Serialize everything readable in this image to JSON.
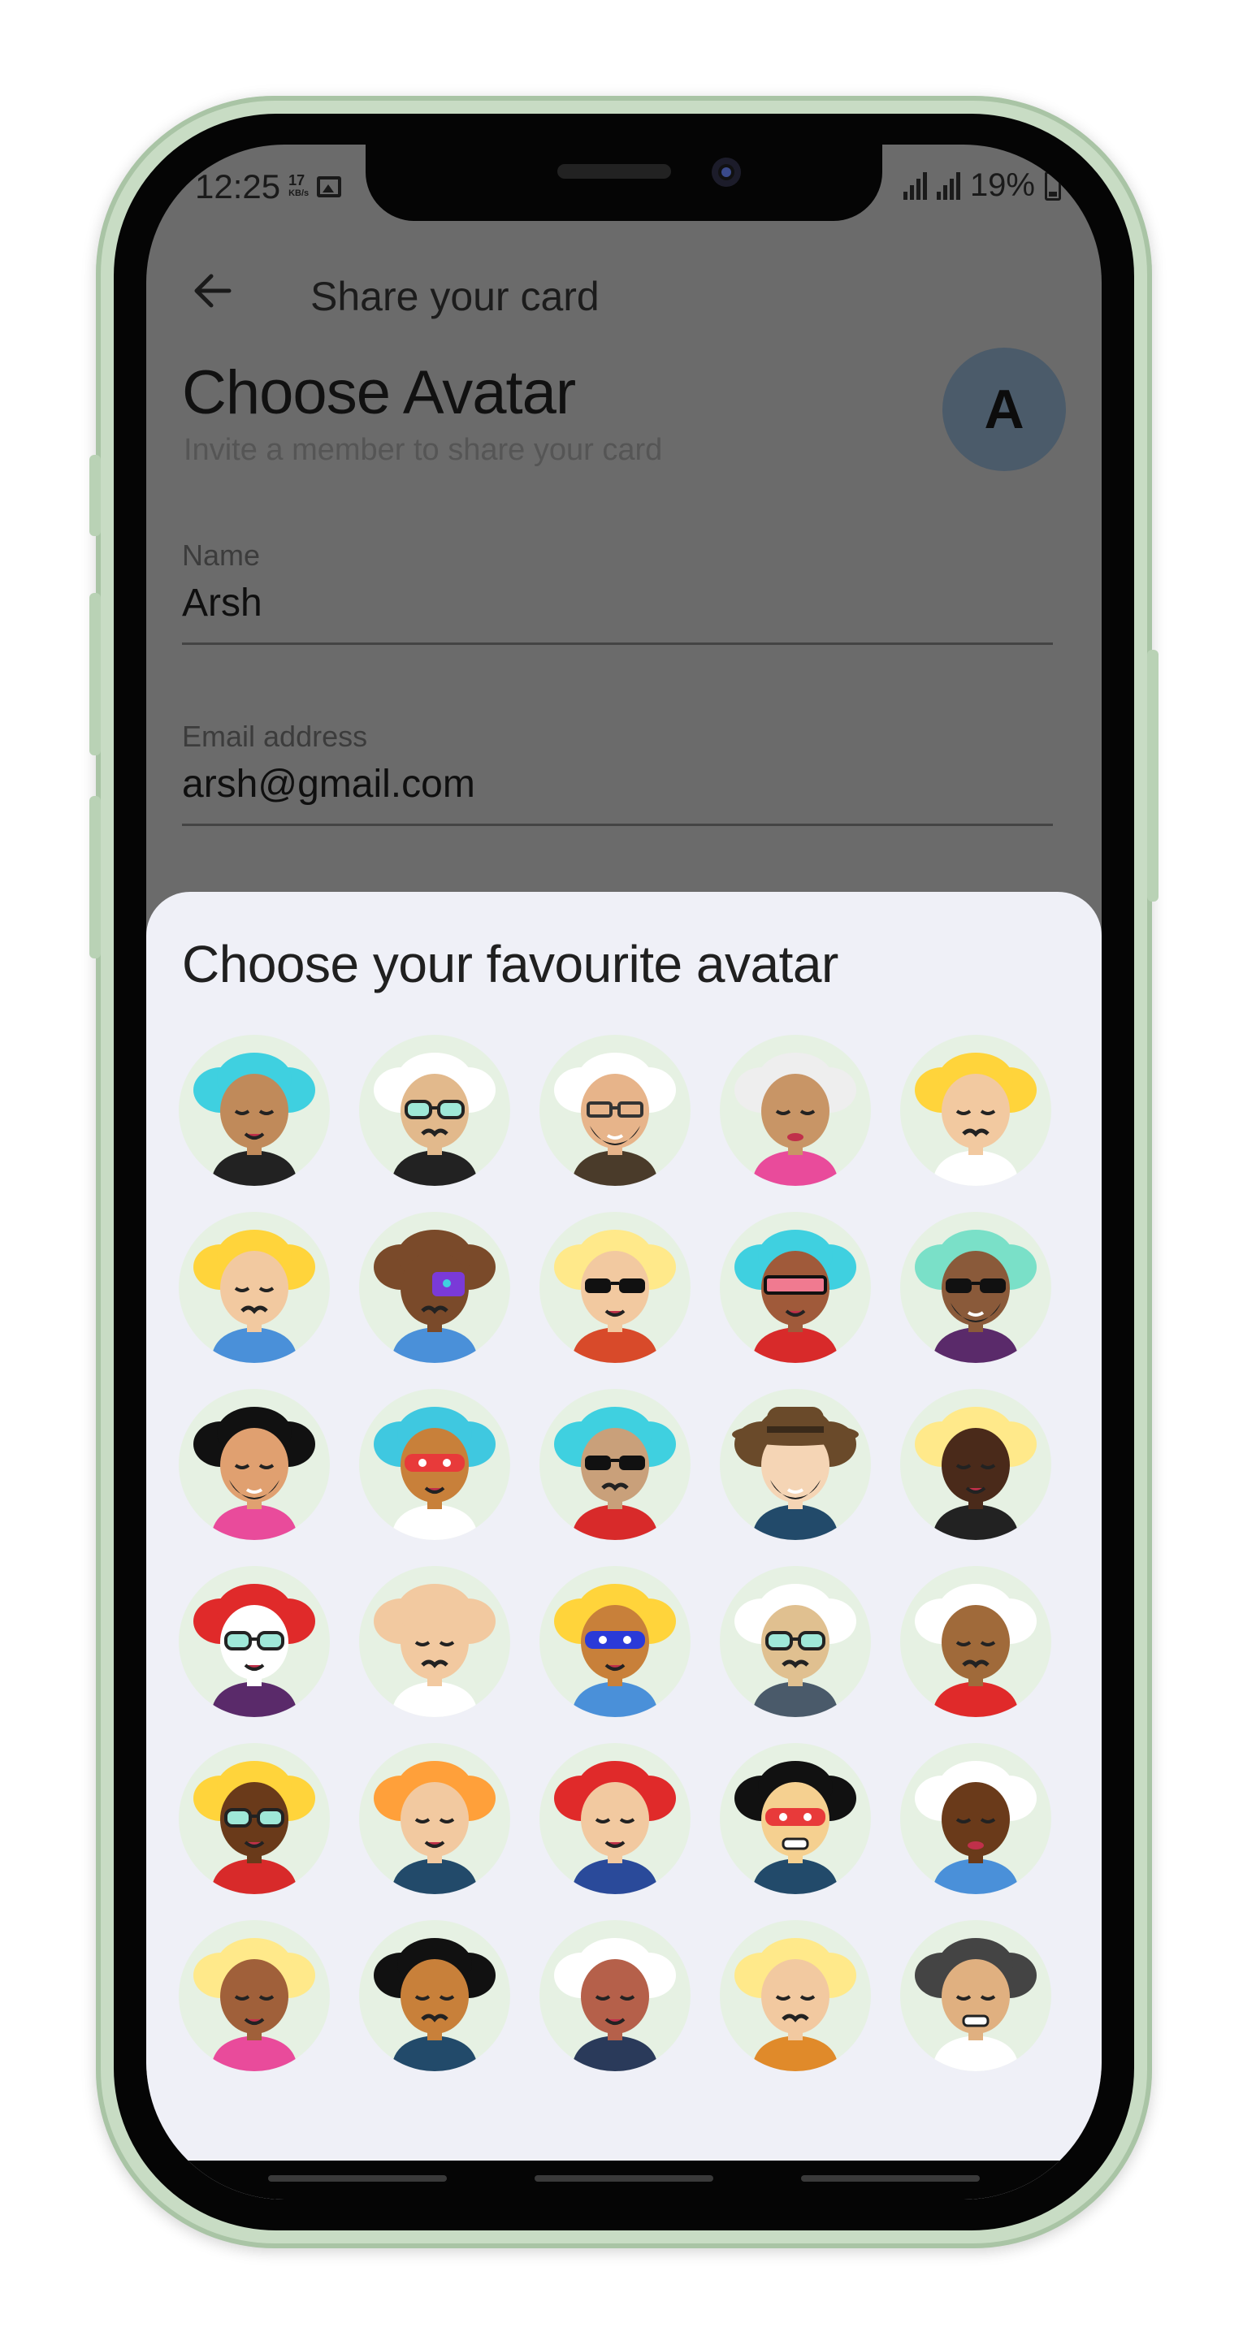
{
  "status_bar": {
    "time": "12:25",
    "speed_value": "17",
    "speed_unit": "KB/s",
    "battery": "19%"
  },
  "appbar": {
    "back_icon": "back-arrow-icon",
    "title": "Share your card"
  },
  "header": {
    "title": "Choose Avatar",
    "subtitle": "Invite a member to share your card",
    "avatar_initial": "A"
  },
  "form": {
    "name_label": "Name",
    "name_value": "Arsh",
    "email_label": "Email address",
    "email_value": "arsh@gmail.com"
  },
  "sheet": {
    "title": "Choose your favourite avatar",
    "avatars": [
      {
        "skin": "#c08a5a",
        "hair": "#3fd0e0",
        "acc": "none",
        "shirt": "#222222",
        "mouth": "smile"
      },
      {
        "skin": "#e2b98c",
        "hair": "#ffffff",
        "acc": "glasses-mint",
        "shirt": "#222222",
        "mouth": "mustache"
      },
      {
        "skin": "#e7b48a",
        "hair": "#ffffff",
        "acc": "glasses-outline",
        "shirt": "#4a3b2a",
        "mouth": "beard"
      },
      {
        "skin": "#c89566",
        "hair": "#eeeeee",
        "acc": "none",
        "shirt": "#e94b9b",
        "mouth": "lips"
      },
      {
        "skin": "#f2c9a0",
        "hair": "#ffd43b",
        "acc": "none",
        "shirt": "#ffffff",
        "mouth": "mustache"
      },
      {
        "skin": "#f2c9a0",
        "hair": "#ffd43b",
        "acc": "none",
        "shirt": "#4a90d9",
        "mouth": "mustache"
      },
      {
        "skin": "#7a4a2a",
        "hair": "#7a4a2a",
        "acc": "mask-purple",
        "shirt": "#4a90d9",
        "mouth": "mustache"
      },
      {
        "skin": "#f2c9a0",
        "hair": "#ffe98a",
        "acc": "glasses-black",
        "shirt": "#d84a2a",
        "mouth": "smile"
      },
      {
        "skin": "#a05a3a",
        "hair": "#3fd0e0",
        "acc": "visor-pink",
        "shirt": "#d82a2a",
        "mouth": "smile"
      },
      {
        "skin": "#8a5a3a",
        "hair": "#7ae0c8",
        "acc": "glasses-black",
        "shirt": "#5a2a6a",
        "mouth": "beard"
      },
      {
        "skin": "#e0a070",
        "hair": "#111111",
        "acc": "none",
        "shirt": "#e94b9b",
        "mouth": "beard"
      },
      {
        "skin": "#c8803a",
        "hair": "#3fc8e0",
        "acc": "mask-red",
        "shirt": "#ffffff",
        "mouth": "smile"
      },
      {
        "skin": "#c9a07a",
        "hair": "#3fd0e0",
        "acc": "glasses-black",
        "shirt": "#d82a2a",
        "mouth": "mustache"
      },
      {
        "skin": "#f5d5b5",
        "hair": "#6a4a2a",
        "acc": "hat",
        "shirt": "#224a6a",
        "mouth": "beard"
      },
      {
        "skin": "#4a2a1a",
        "hair": "#ffe98a",
        "acc": "none",
        "shirt": "#222222",
        "mouth": "smile"
      },
      {
        "skin": "#ffffff",
        "hair": "#e02a2a",
        "acc": "glasses-mint",
        "shirt": "#5a2a6a",
        "mouth": "smile"
      },
      {
        "skin": "#f2c9a0",
        "hair": "#f2c9a0",
        "acc": "none",
        "shirt": "#ffffff",
        "mouth": "mustache"
      },
      {
        "skin": "#c8803a",
        "hair": "#ffd43b",
        "acc": "mask-blue",
        "shirt": "#4a90d9",
        "mouth": "smile"
      },
      {
        "skin": "#e0c090",
        "hair": "#ffffff",
        "acc": "glasses-mint",
        "shirt": "#4a5a6a",
        "mouth": "mustache"
      },
      {
        "skin": "#a06a3a",
        "hair": "#ffffff",
        "acc": "none",
        "shirt": "#e02a2a",
        "mouth": "mustache"
      },
      {
        "skin": "#6a3a1a",
        "hair": "#ffd43b",
        "acc": "glasses-mint",
        "shirt": "#d82a2a",
        "mouth": "smile"
      },
      {
        "skin": "#f2c9a0",
        "hair": "#ffa03a",
        "acc": "none",
        "shirt": "#224a6a",
        "mouth": "smile"
      },
      {
        "skin": "#f2c9a0",
        "hair": "#e02a2a",
        "acc": "none",
        "shirt": "#2a4a9a",
        "mouth": "smile"
      },
      {
        "skin": "#f5d090",
        "hair": "#111111",
        "acc": "mask-red",
        "shirt": "#224a6a",
        "mouth": "teeth"
      },
      {
        "skin": "#6a3a1a",
        "hair": "#ffffff",
        "acc": "none",
        "shirt": "#4a90d9",
        "mouth": "lips"
      },
      {
        "skin": "#a0603a",
        "hair": "#ffe98a",
        "acc": "none",
        "shirt": "#e94b9b",
        "mouth": "smile"
      },
      {
        "skin": "#c8803a",
        "hair": "#111111",
        "acc": "none",
        "shirt": "#224a6a",
        "mouth": "mustache"
      },
      {
        "skin": "#b5604a",
        "hair": "#ffffff",
        "acc": "none",
        "shirt": "#2a3a5a",
        "mouth": "smile"
      },
      {
        "skin": "#f2c9a0",
        "hair": "#ffe98a",
        "acc": "none",
        "shirt": "#e08a2a",
        "mouth": "mustache"
      },
      {
        "skin": "#e0b080",
        "hair": "#444444",
        "acc": "none",
        "shirt": "#ffffff",
        "mouth": "teeth"
      }
    ]
  }
}
